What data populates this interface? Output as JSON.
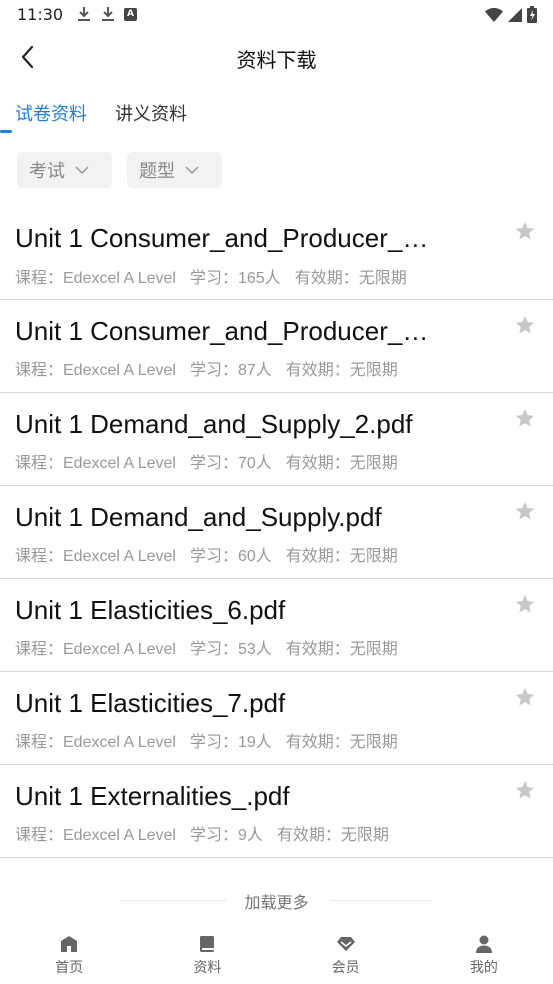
{
  "status_bar": {
    "time": "11:30",
    "a_glyph": "A"
  },
  "header": {
    "title": "资料下载"
  },
  "tabs": [
    {
      "label": "试卷资料",
      "active": true
    },
    {
      "label": "讲义资料",
      "active": false
    }
  ],
  "filters": [
    {
      "label": "考试"
    },
    {
      "label": "题型"
    }
  ],
  "items": [
    {
      "title": "Unit 1 Consumer_and_Producer_…",
      "course": "课程：Edexcel A Level",
      "learners": "学习：165人",
      "validity": "有效期：无限期"
    },
    {
      "title": "Unit 1 Consumer_and_Producer_…",
      "course": "课程：Edexcel A Level",
      "learners": "学习：87人",
      "validity": "有效期：无限期"
    },
    {
      "title": "Unit 1 Demand_and_Supply_2.pdf",
      "course": "课程：Edexcel A Level",
      "learners": "学习：70人",
      "validity": "有效期：无限期"
    },
    {
      "title": "Unit 1 Demand_and_Supply.pdf",
      "course": "课程：Edexcel A Level",
      "learners": "学习：60人",
      "validity": "有效期：无限期"
    },
    {
      "title": "Unit 1 Elasticities_6.pdf",
      "course": "课程：Edexcel A Level",
      "learners": "学习：53人",
      "validity": "有效期：无限期"
    },
    {
      "title": "Unit 1 Elasticities_7.pdf",
      "course": "课程：Edexcel A Level",
      "learners": "学习：19人",
      "validity": "有效期：无限期"
    },
    {
      "title": "Unit 1 Externalities_.pdf",
      "course": "课程：Edexcel A Level",
      "learners": "学习：9人",
      "validity": "有效期：无限期"
    }
  ],
  "load_more": {
    "label": "加载更多"
  },
  "bottom_nav": [
    {
      "label": "首页",
      "icon": "home-icon"
    },
    {
      "label": "资料",
      "icon": "book-icon"
    },
    {
      "label": "会员",
      "icon": "diamond-icon"
    },
    {
      "label": "我的",
      "icon": "user-icon"
    }
  ],
  "colors": {
    "accent": "#1a7fe0",
    "star": "#c8c8c8",
    "divider": "#d8d8d8",
    "muted": "#999999"
  }
}
